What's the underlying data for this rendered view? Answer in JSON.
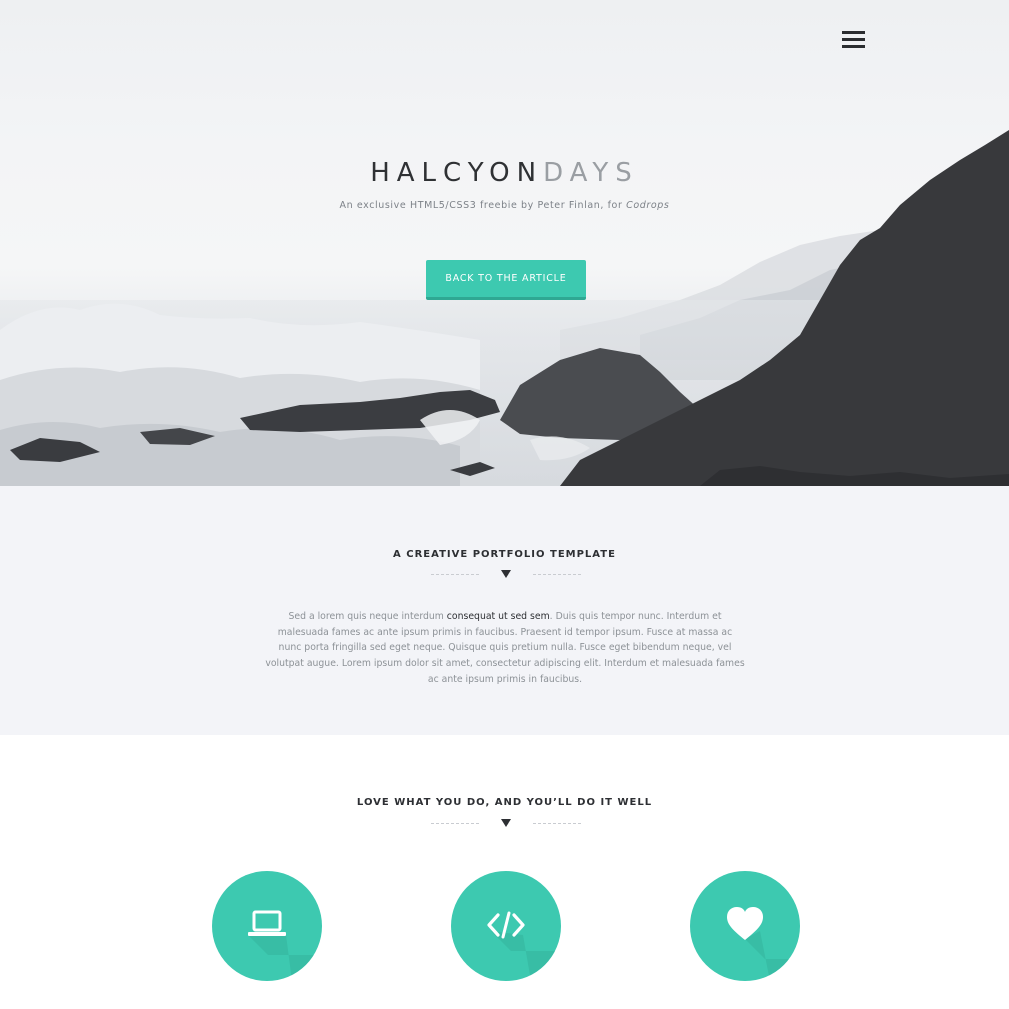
{
  "hero": {
    "brand_part1": "HALCYON",
    "brand_part2": "DAYS",
    "tagline": "An exclusive HTML5/CSS3 freebie by Peter Finlan, for",
    "tagline_source": "Codrops",
    "cta_label": "BACK TO THE ARTICLE",
    "menu_icon": "hamburger-menu-icon"
  },
  "intro": {
    "title": "A CREATIVE PORTFOLIO TEMPLATE",
    "paragraph_start": "Sed a lorem quis neque interdum ",
    "paragraph_highlight": "consequat ut sed sem",
    "paragraph_rest": ". Duis quis tempor nunc. Interdum et malesuada fames ac ante ipsum primis in faucibus. Praesent id tempor ipsum. Fusce at massa ac nunc porta fringilla sed eget neque. Quisque quis pretium nulla. Fusce eget bibendum neque, vel volutpat augue. Lorem ipsum dolor sit amet, consectetur adipiscing elit. Interdum et malesuada fames ac ante ipsum primis in faucibus."
  },
  "features": {
    "title": "LOVE WHAT YOU DO, AND YOU’LL DO IT WELL",
    "icons": [
      "laptop-icon",
      "code-icon",
      "heart-icon"
    ]
  },
  "colors": {
    "accent": "#3dc9b0",
    "accent_dark": "#2fa893",
    "text_dark": "#2d2f33",
    "text_muted": "#8d9297",
    "section_bg": "#f3f4f8"
  }
}
